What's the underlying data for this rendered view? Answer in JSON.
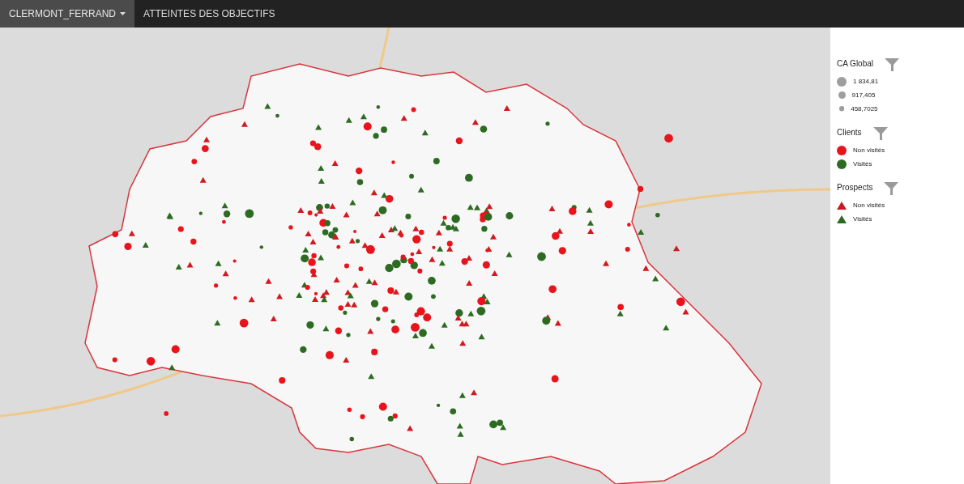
{
  "nav": {
    "tabs": [
      {
        "label": "CLERMONT_FERRAND",
        "selected": true,
        "dropdown": true
      },
      {
        "label": "ATTEINTES DES OBJECTIFS",
        "selected": false,
        "dropdown": false
      }
    ]
  },
  "legend": {
    "sections": [
      {
        "title": "CA Global",
        "items": [
          {
            "kind": "large",
            "label": "1 834,81",
            "color": "#9e9e9e"
          },
          {
            "kind": "medium",
            "label": "917,405",
            "color": "#9e9e9e"
          },
          {
            "kind": "small",
            "label": "458,7025",
            "color": "#9e9e9e"
          }
        ]
      },
      {
        "title": "Clients",
        "items": [
          {
            "kind": "dot",
            "label": "Non visités",
            "color": "#e8141b"
          },
          {
            "kind": "dot",
            "label": "Visités",
            "color": "#2e6b22"
          }
        ]
      },
      {
        "title": "Prospects",
        "items": [
          {
            "kind": "triangle",
            "label": "Non visités",
            "color": "#c8191f"
          },
          {
            "kind": "triangle",
            "label": "Visités",
            "color": "#2e6b22"
          }
        ]
      }
    ]
  }
}
